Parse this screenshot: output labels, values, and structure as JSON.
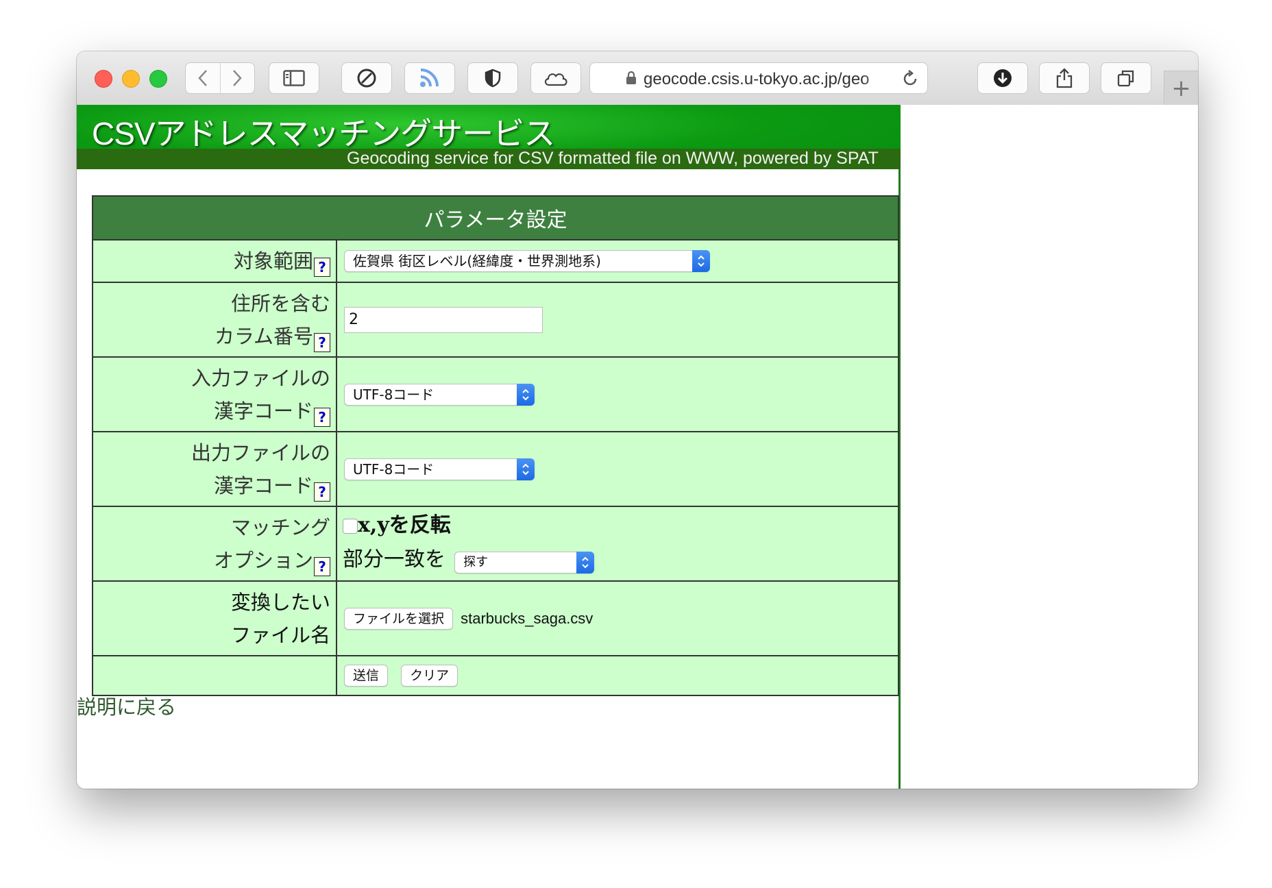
{
  "browser": {
    "url": "geocode.csis.u-tokyo.ac.jp/geo",
    "new_tab": "+"
  },
  "page": {
    "banner_title": "CSVアドレスマッチングサービス",
    "banner_subtitle": "Geocoding service for CSV formatted file on WWW, powered by SPAT",
    "table_header": "パラメータ設定",
    "help_mark": "?",
    "rows": {
      "range": {
        "label": "対象範囲",
        "selected": "佐賀県 街区レベル(経緯度・世界測地系)"
      },
      "column": {
        "label_line1": "住所を含む",
        "label_line2": "カラム番号",
        "value": "2"
      },
      "input_encoding": {
        "label_line1": "入力ファイルの",
        "label_line2": "漢字コード",
        "selected": "UTF-8コード"
      },
      "output_encoding": {
        "label_line1": "出力ファイルの",
        "label_line2": "漢字コード",
        "selected": "UTF-8コード"
      },
      "matching": {
        "label_line1": "マッチング",
        "label_line2": "オプション",
        "flip_xy_label": "x,yを反転",
        "flip_xy_checked": false,
        "partial_label": "部分一致を",
        "partial_selected": "探す"
      },
      "file": {
        "label_line1": "変換したい",
        "label_line2": "ファイル名",
        "choose_button": "ファイルを選択",
        "file_name": "starbucks_saga.csv"
      },
      "actions": {
        "submit": "送信",
        "clear": "クリア"
      }
    },
    "back_link": "説明に戻る"
  }
}
